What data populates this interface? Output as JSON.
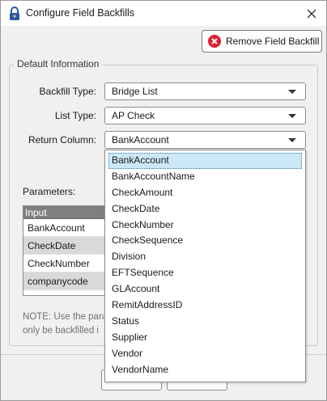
{
  "window": {
    "title": "Configure Field Backfills",
    "close_glyph": "✕"
  },
  "toolbar": {
    "remove_label": "Remove Field Backfill",
    "remove_icon": "remove-circle-icon"
  },
  "group": {
    "title": "Default Information"
  },
  "fields": {
    "backfill_type": {
      "label": "Backfill Type:",
      "value": "Bridge List"
    },
    "list_type": {
      "label": "List Type:",
      "value": "AP Check"
    },
    "return_column": {
      "label": "Return Column:",
      "value": "BankAccount"
    }
  },
  "parameters": {
    "label": "Parameters:",
    "header": "Input",
    "rows": [
      "BankAccount",
      "CheckDate",
      "CheckNumber",
      "companycode"
    ]
  },
  "note": {
    "line1": "NOTE: Use the para",
    "line2": "only be backfilled i"
  },
  "dropdown": {
    "selected": "BankAccount",
    "options": [
      "BankAccount",
      "BankAccountName",
      "CheckAmount",
      "CheckDate",
      "CheckNumber",
      "CheckSequence",
      "Division",
      "EFTSequence",
      "GLAccount",
      "RemitAddressID",
      "Status",
      "Supplier",
      "Vendor",
      "VendorName"
    ]
  },
  "colors": {
    "accent_selection": "#cce8f6",
    "remove_icon": "#e0202f",
    "lock_icon": "#2b5aa8"
  }
}
